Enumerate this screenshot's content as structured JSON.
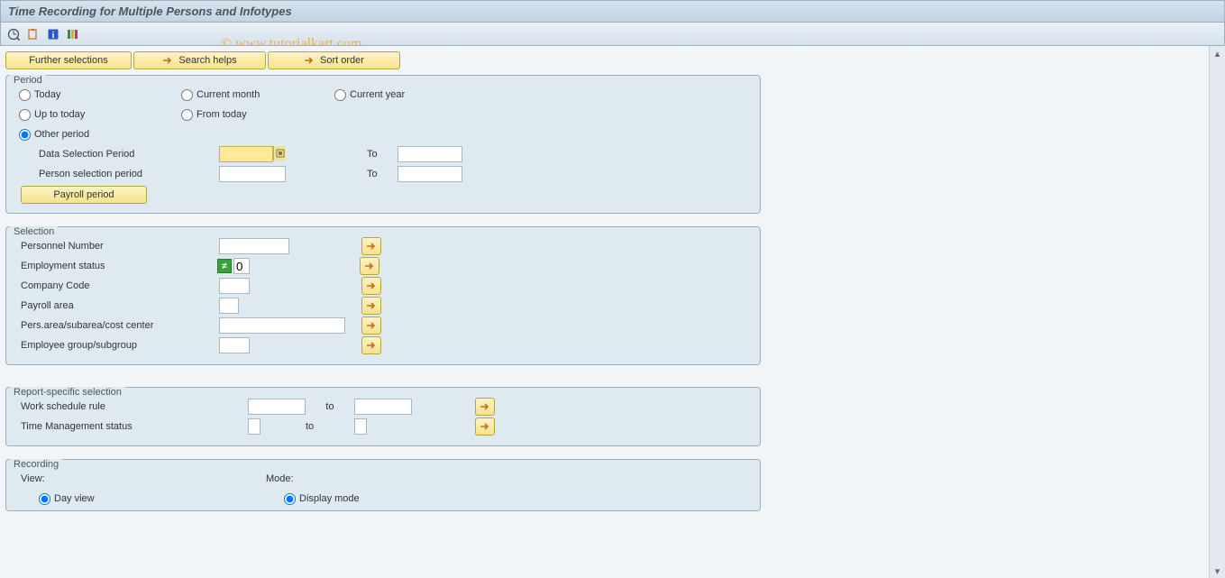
{
  "title": "Time Recording for Multiple Persons and Infotypes",
  "watermark": "© www.tutorialkart.com",
  "btnbar": {
    "further": "Further selections",
    "search": "Search helps",
    "sort": "Sort order"
  },
  "period": {
    "legend": "Period",
    "today": "Today",
    "current_month": "Current month",
    "current_year": "Current year",
    "up_to_today": "Up to today",
    "from_today": "From today",
    "other_period": "Other period",
    "data_sel": "Data Selection Period",
    "person_sel": "Person selection period",
    "to": "To",
    "payroll_btn": "Payroll period"
  },
  "selection": {
    "legend": "Selection",
    "personnel": "Personnel Number",
    "emp_status": "Employment status",
    "emp_status_val": "0",
    "company": "Company Code",
    "payroll_area": "Payroll area",
    "pers_area": "Pers.area/subarea/cost center",
    "emp_group": "Employee group/subgroup"
  },
  "report": {
    "legend": "Report-specific selection",
    "work_rule": "Work schedule rule",
    "time_mgmt": "Time Management status",
    "to": "to"
  },
  "recording": {
    "legend": "Recording",
    "view": "View:",
    "mode": "Mode:",
    "day_view": "Day view",
    "display_mode": "Display mode"
  }
}
